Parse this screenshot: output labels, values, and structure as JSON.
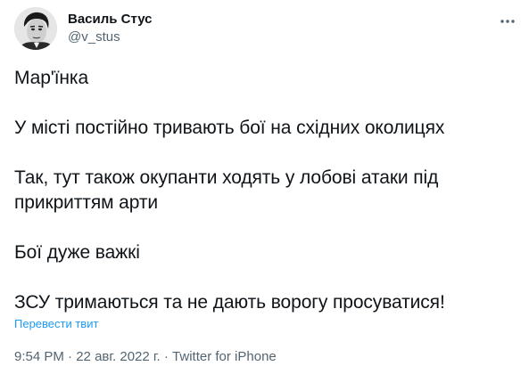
{
  "author": {
    "display_name": "Василь Стус",
    "handle": "@v_stus",
    "avatar_icon": "portrait-avatar"
  },
  "more_icon": "more-horizontal-icon",
  "tweet": {
    "paragraphs": [
      "Мар'їнка",
      "У місті постійно тривають бої на східних околицях",
      "Так, тут також окупанти ходять у лобові атаки під прикриттям арти",
      "Бої дуже важкі",
      "ЗСУ тримаються та не дають ворогу просуватися!"
    ],
    "translate_label": "Перевести твит"
  },
  "meta": {
    "time": "9:54 PM",
    "separator": " · ",
    "date": "22 авг. 2022 г.",
    "source": "Twitter for iPhone"
  },
  "colors": {
    "text": "#0f1419",
    "secondary": "#536471",
    "link": "#1d9bf0"
  }
}
